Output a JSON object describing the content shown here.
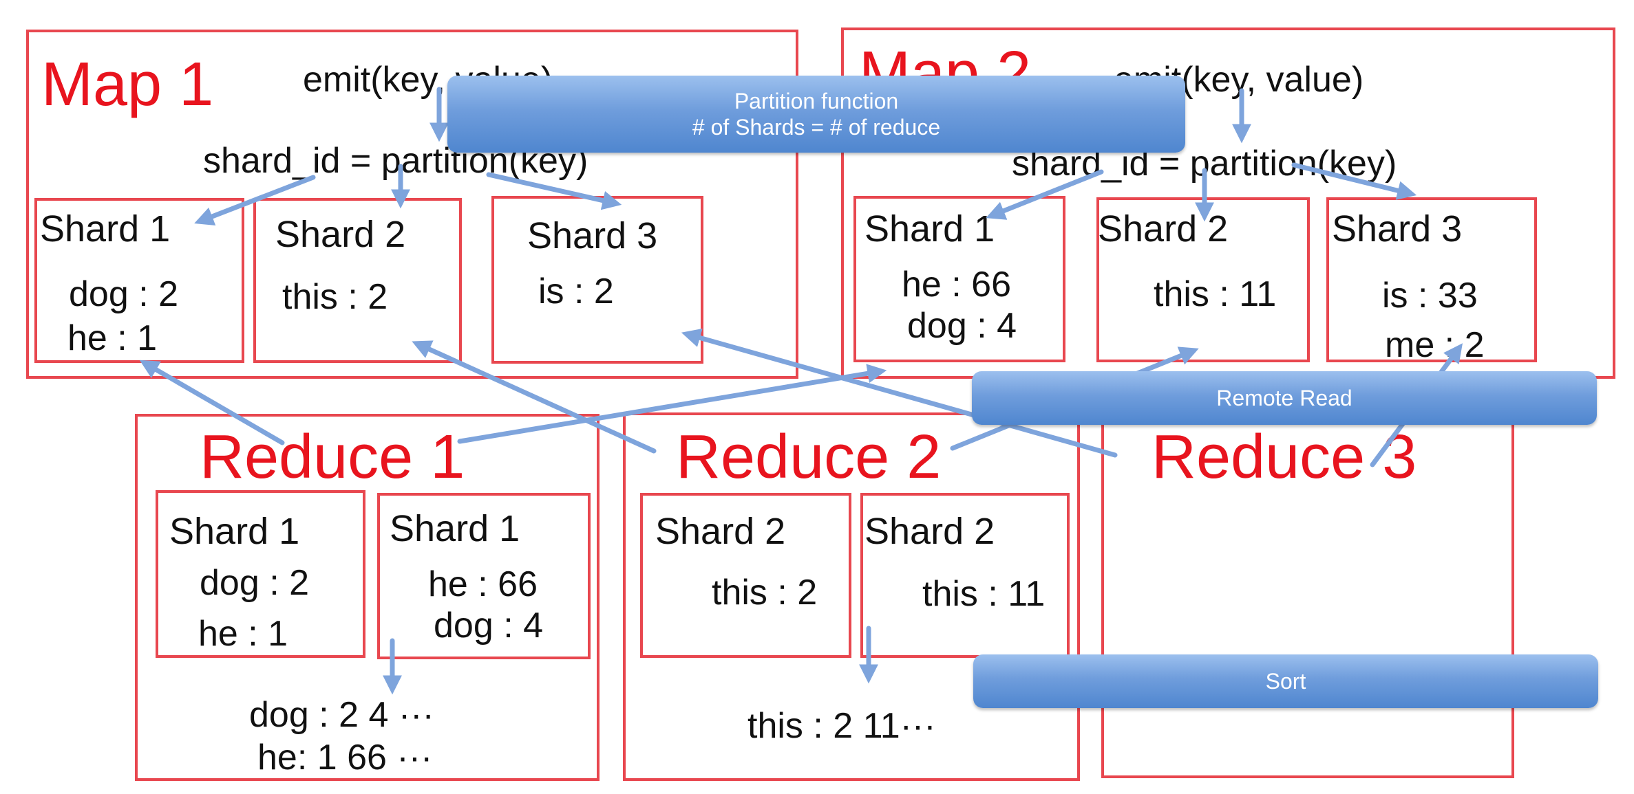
{
  "colors": {
    "box_border": "#e8474f",
    "title_red": "#e8141e",
    "arrow_blue": "#7ea4dc",
    "callout_blue": "#5b8fd4"
  },
  "map1": {
    "title": "Map 1",
    "emit": "emit(key, value)",
    "shard_assign": "shard_id = partition(key)",
    "shards": [
      {
        "label": "Shard 1",
        "lines": [
          "dog : 2",
          "he : 1"
        ]
      },
      {
        "label": "Shard 2",
        "lines": [
          "this : 2"
        ]
      },
      {
        "label": "Shard 3",
        "lines": [
          "is : 2"
        ]
      }
    ]
  },
  "map2": {
    "title": "Map 2",
    "emit": "emit(key, value)",
    "shard_assign": "shard_id = partition(key)",
    "shards": [
      {
        "label": "Shard 1",
        "lines": [
          "he : 66",
          "dog : 4"
        ]
      },
      {
        "label": "Shard 2",
        "lines": [
          "this : 11"
        ]
      },
      {
        "label": "Shard 3",
        "lines": [
          "is : 33",
          "me : 2"
        ]
      }
    ]
  },
  "reduce1": {
    "title": "Reduce 1",
    "shards": [
      {
        "label": "Shard 1",
        "lines": [
          "dog : 2",
          "he : 1"
        ]
      },
      {
        "label": "Shard 1",
        "lines": [
          "he : 66",
          "dog : 4"
        ]
      }
    ],
    "merged": [
      "dog : 2  4 ···",
      "he: 1  66 ···"
    ]
  },
  "reduce2": {
    "title": "Reduce 2",
    "shards": [
      {
        "label": "Shard 2",
        "lines": [
          "this : 2"
        ]
      },
      {
        "label": "Shard 2",
        "lines": [
          "this : 11"
        ]
      }
    ],
    "merged": [
      "this :  2 11···"
    ]
  },
  "reduce3": {
    "title": "Reduce 3"
  },
  "callouts": {
    "partition_title": "Partition function",
    "partition_sub": "# of Shards = # of reduce",
    "remote_read": "Remote Read",
    "sort": "Sort"
  }
}
